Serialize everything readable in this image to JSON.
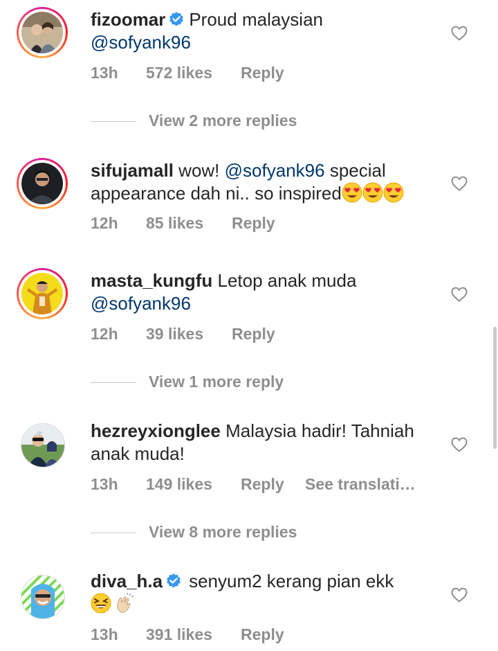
{
  "colors": {
    "text": "#262626",
    "secondary": "#8e8e8e",
    "mention": "#00376b",
    "verified": "#3897f0",
    "story_ring": "#d6249f"
  },
  "comments": [
    {
      "username": "fizoomar",
      "verified": true,
      "story_ring": true,
      "text_parts": [
        "Proud malaysian"
      ],
      "mention": "@sofyank96",
      "time": "13h",
      "likes": "572 likes",
      "reply": "Reply",
      "view_more": "View 2 more replies"
    },
    {
      "username": "sifujamall",
      "verified": false,
      "story_ring": true,
      "text_before": "wow!",
      "mention": "@sofyank96",
      "text_after": "special appearance dah ni.. so inspired",
      "emojis": [
        "heart-eyes-emoji",
        "heart-eyes-emoji",
        "heart-eyes-emoji"
      ],
      "time": "12h",
      "likes": "85 likes",
      "reply": "Reply"
    },
    {
      "username": "masta_kungfu",
      "verified": false,
      "story_ring": true,
      "text": "Letop anak muda",
      "mention": "@sofyank96",
      "time": "12h",
      "likes": "39 likes",
      "reply": "Reply",
      "view_more": "View 1 more reply"
    },
    {
      "username": "hezreyxionglee",
      "verified": false,
      "story_ring": false,
      "text": "Malaysia hadir! Tahniah anak muda!",
      "time": "13h",
      "likes": "149 likes",
      "reply": "Reply",
      "see_translation": "See translati…",
      "view_more": "View 8 more replies"
    },
    {
      "username": "diva_h.a",
      "verified": true,
      "story_ring": false,
      "text": "senyum2 kerang pian ekk",
      "emojis": [
        "laughing-emoji",
        "clapping-hands-emoji"
      ],
      "time": "13h",
      "likes": "391 likes",
      "reply": "Reply"
    }
  ]
}
